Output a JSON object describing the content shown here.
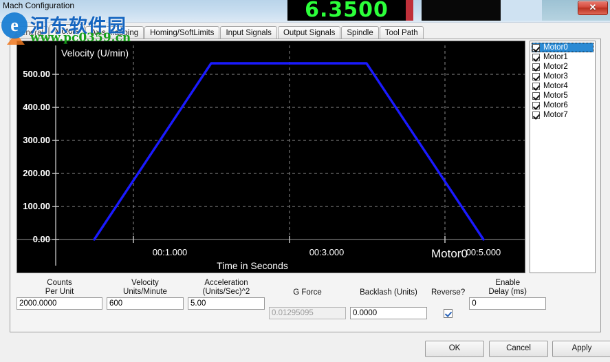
{
  "background": {
    "dro_value": "6.3500",
    "close_label": "✕"
  },
  "window": {
    "title": "Mach Configuration"
  },
  "tabs": [
    {
      "label": "General",
      "active": false
    },
    {
      "label": "Motors",
      "active": true
    },
    {
      "label": "Axis Mapping",
      "active": false
    },
    {
      "label": "Homing/SoftLimits",
      "active": false
    },
    {
      "label": "Input Signals",
      "active": false
    },
    {
      "label": "Output Signals",
      "active": false
    },
    {
      "label": "Spindle",
      "active": false
    },
    {
      "label": "Tool Path",
      "active": false
    }
  ],
  "chart_data": {
    "type": "line",
    "title": "Velocity (U/min)",
    "xlabel": "Time in Seconds",
    "ylabel": "",
    "series_label": "Motor0",
    "line_color": "#1a1aff",
    "background": "#000000",
    "grid": true,
    "grid_color": "#8a8a8a",
    "text_color": "#ffffff",
    "x": [
      0.5,
      1.0,
      2.0,
      3.0,
      4.0,
      5.0,
      5.6
    ],
    "y": [
      0,
      120,
      575,
      575,
      575,
      170,
      0
    ],
    "xlim": [
      0,
      6.0
    ],
    "ylim": [
      0,
      600
    ],
    "yticks": [
      0,
      100,
      200,
      300,
      400,
      500
    ],
    "ytick_labels": [
      "0.00",
      "100.00",
      "200.00",
      "300.00",
      "400.00",
      "500.00"
    ],
    "xticks": [
      1,
      3,
      5
    ],
    "xtick_labels": [
      "00:1.000",
      "00:3.000",
      "00:5.000"
    ],
    "annotation": "Motor0"
  },
  "motor_list": {
    "items": [
      {
        "label": "Motor0",
        "checked": true,
        "selected": true
      },
      {
        "label": "Motor1",
        "checked": true,
        "selected": false
      },
      {
        "label": "Motor2",
        "checked": true,
        "selected": false
      },
      {
        "label": "Motor3",
        "checked": true,
        "selected": false
      },
      {
        "label": "Motor4",
        "checked": true,
        "selected": false
      },
      {
        "label": "Motor5",
        "checked": true,
        "selected": false
      },
      {
        "label": "Motor6",
        "checked": true,
        "selected": false
      },
      {
        "label": "Motor7",
        "checked": true,
        "selected": false
      }
    ]
  },
  "fields": {
    "counts": {
      "label": "Counts\nPer Unit",
      "value": "2000.0000",
      "disabled": false
    },
    "velocity": {
      "label": "Velocity\nUnits/Minute",
      "value": "600",
      "disabled": false
    },
    "acceleration": {
      "label": "Acceleration\n(Units/Sec)^2",
      "value": "5.00",
      "disabled": false
    },
    "gforce": {
      "label": "G Force",
      "value": "0.01295095",
      "disabled": true
    },
    "backlash": {
      "label": "Backlash (Units)",
      "value": "0.0000",
      "disabled": false
    },
    "reverse": {
      "label": "Reverse?",
      "checked": true
    },
    "enable_delay": {
      "label": "Enable\nDelay (ms)",
      "value": "0",
      "disabled": false
    }
  },
  "buttons": {
    "ok": "OK",
    "cancel": "Cancel",
    "apply": "Apply"
  },
  "watermark": {
    "logo_glyph": "e",
    "site_name": "河东软件园",
    "url": "www.pc0359.cn"
  }
}
